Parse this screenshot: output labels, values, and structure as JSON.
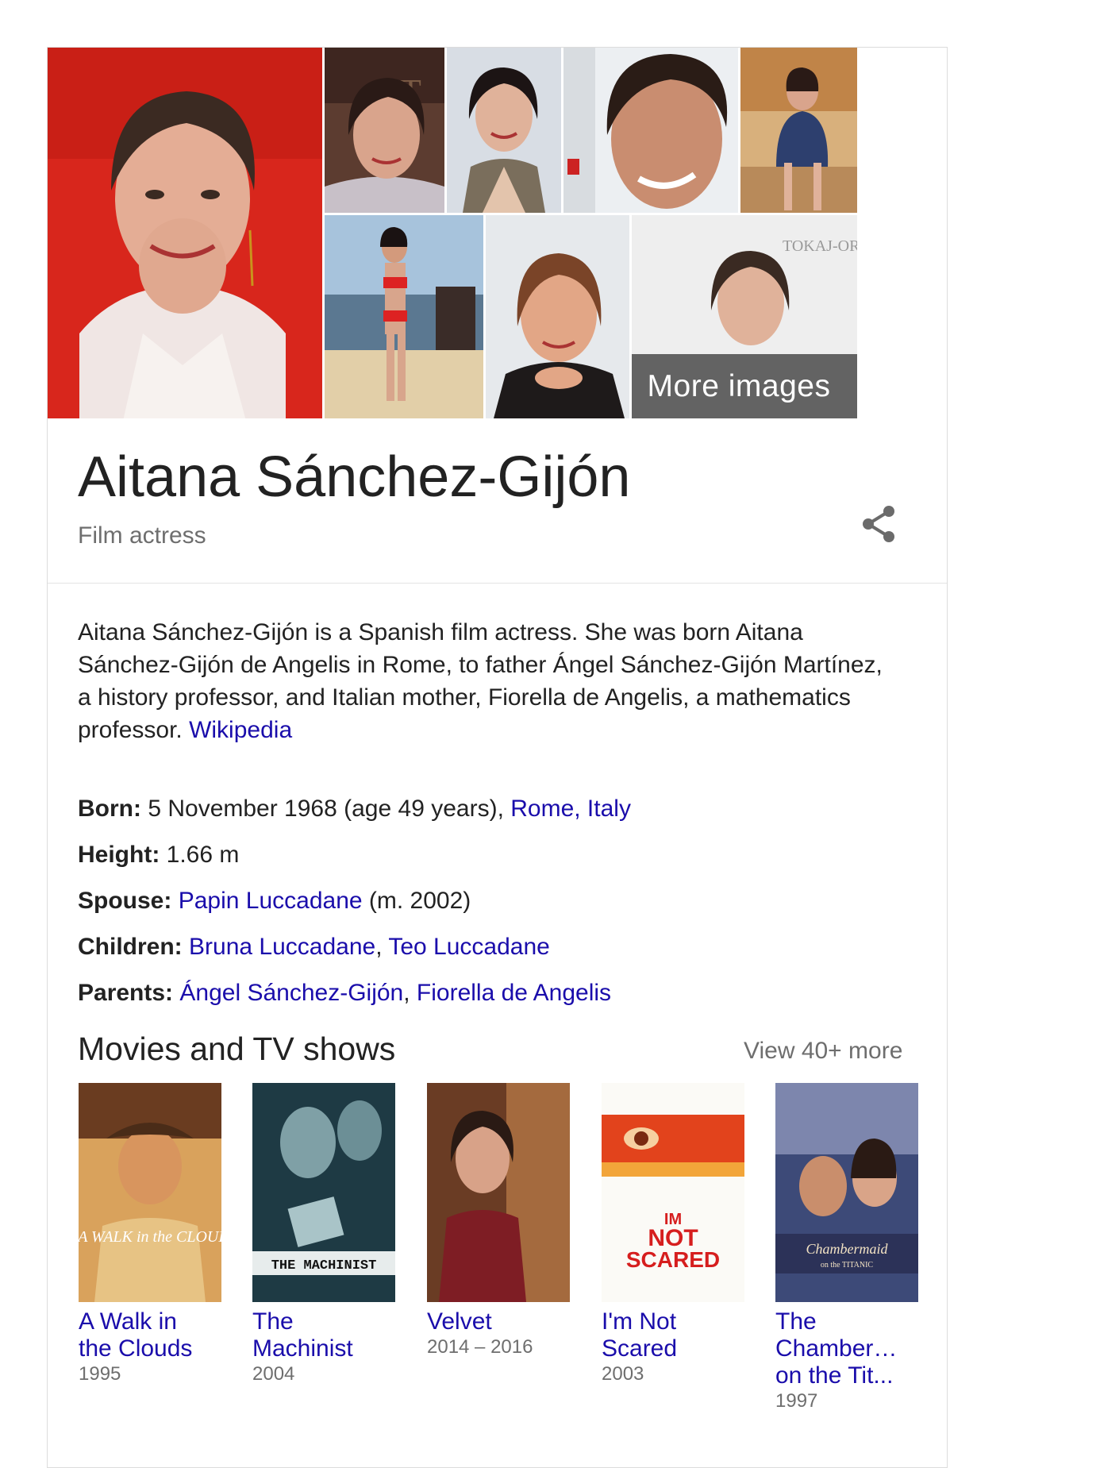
{
  "images": {
    "more_images_label": "More images"
  },
  "entity": {
    "name": "Aitana Sánchez-Gijón",
    "type": "Film actress"
  },
  "description": {
    "text": "Aitana Sánchez-Gijón is a Spanish film actress. She was born Aitana Sánchez-Gijón de Angelis in Rome, to father Ángel Sánchez-Gijón Martínez, a history professor, and Italian mother, Fiorella de Angelis, a mathematics professor.",
    "source_link": "Wikipedia"
  },
  "facts": {
    "born": {
      "label": "Born:",
      "value": " 5 November 1968 (age 49 years), ",
      "link": "Rome, Italy"
    },
    "height": {
      "label": "Height:",
      "value": " 1.66 m"
    },
    "spouse": {
      "label": "Spouse:",
      "link": "Papin Luccadane",
      "value": " (m. 2002)"
    },
    "children": {
      "label": "Children:",
      "links": [
        "Bruna Luccadane",
        "Teo Luccadane"
      ],
      "sep": ", "
    },
    "parents": {
      "label": "Parents:",
      "links": [
        "Ángel Sánchez-Gijón",
        "Fiorella de Angelis"
      ],
      "sep": ", "
    }
  },
  "movies": {
    "section_title": "Movies and TV shows",
    "view_more": "View 40+ more",
    "items": [
      {
        "title_line1": "A Walk in",
        "title_line2": "the Clouds",
        "title_line3": "",
        "year": "1995"
      },
      {
        "title_line1": "The",
        "title_line2": "Machinist",
        "title_line3": "",
        "year": "2004"
      },
      {
        "title_line1": "Velvet",
        "title_line2": "",
        "title_line3": "",
        "year": "2014 – 2016"
      },
      {
        "title_line1": "I'm Not",
        "title_line2": "Scared",
        "title_line3": "",
        "year": "2003"
      },
      {
        "title_line1": "The",
        "title_line2": "Chamber…",
        "title_line3": "on the Tit...",
        "year": "1997"
      }
    ],
    "poster_text": {
      "walk": "A WALK in the CLOUDS",
      "machinist": "THE MACHINIST",
      "scared_top": "IM",
      "scared_mid": "NOT",
      "scared_bottom": "SCARED",
      "chambermaid": "Chambermaid",
      "chambermaid_sub": "on the TITANIC"
    }
  },
  "colors": {
    "link": "#1a0dab",
    "secondary_text": "#6e6e6e",
    "primary_text": "#222222"
  }
}
